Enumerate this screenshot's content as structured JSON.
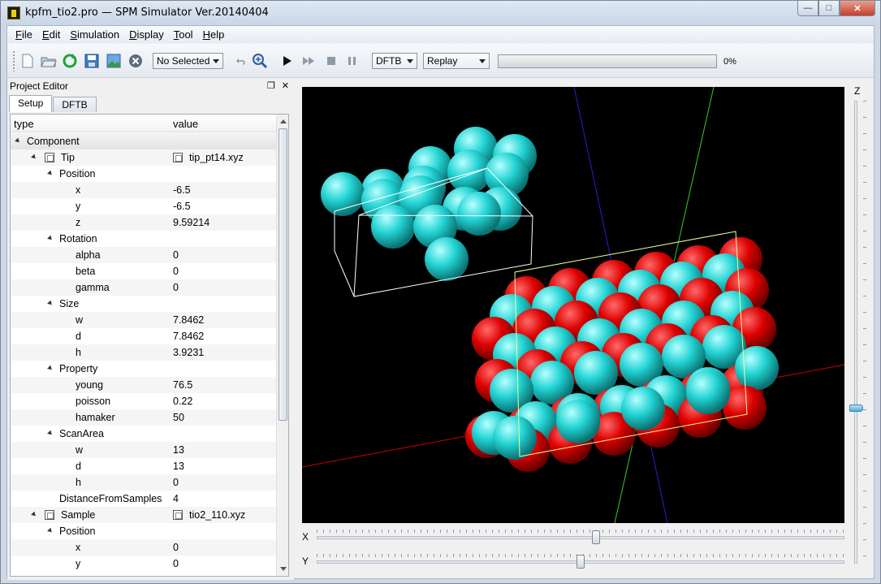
{
  "window": {
    "title": "kpfm_tio2.pro — SPM Simulator Ver.20140404",
    "controls": {
      "minimize": "—",
      "maximize": "□",
      "close": "✕"
    }
  },
  "menu": [
    {
      "first": "F",
      "rest": "ile"
    },
    {
      "first": "E",
      "rest": "dit"
    },
    {
      "first": "S",
      "rest": "imulation"
    },
    {
      "first": "D",
      "rest": "isplay"
    },
    {
      "first": "T",
      "rest": "ool"
    },
    {
      "first": "H",
      "rest": "elp"
    }
  ],
  "toolbar": {
    "selection": "No Selected",
    "mode": "DFTB",
    "playback": "Replay",
    "progress": 0,
    "progress_text": "0%",
    "icons": [
      "new-file-icon",
      "open-folder-icon",
      "refresh-icon",
      "save-icon",
      "image-icon",
      "cancel-icon",
      "undo-icon",
      "zoom-icon",
      "play-icon",
      "fast-forward-icon",
      "stop-icon",
      "pause-icon"
    ]
  },
  "panel": {
    "title": "Project Editor",
    "tabs": [
      "Setup",
      "DFTB"
    ],
    "columns": [
      "type",
      "value"
    ],
    "rows": [
      {
        "level": 0,
        "name": "Component",
        "value": "",
        "expand": true,
        "icon": false,
        "group": true
      },
      {
        "level": 1,
        "name": "Tip",
        "value": "tip_pt14.xyz",
        "expand": true,
        "icon": true
      },
      {
        "level": 2,
        "name": "Position",
        "value": "",
        "expand": true
      },
      {
        "level": 3,
        "name": "x",
        "value": "-6.5"
      },
      {
        "level": 3,
        "name": "y",
        "value": "-6.5"
      },
      {
        "level": 3,
        "name": "z",
        "value": "9.59214"
      },
      {
        "level": 2,
        "name": "Rotation",
        "value": "",
        "expand": true
      },
      {
        "level": 3,
        "name": "alpha",
        "value": "0"
      },
      {
        "level": 3,
        "name": "beta",
        "value": "0"
      },
      {
        "level": 3,
        "name": "gamma",
        "value": "0"
      },
      {
        "level": 2,
        "name": "Size",
        "value": "",
        "expand": true
      },
      {
        "level": 3,
        "name": "w",
        "value": "7.8462"
      },
      {
        "level": 3,
        "name": "d",
        "value": "7.8462"
      },
      {
        "level": 3,
        "name": "h",
        "value": "3.9231"
      },
      {
        "level": 2,
        "name": "Property",
        "value": "",
        "expand": true
      },
      {
        "level": 3,
        "name": "young",
        "value": "76.5"
      },
      {
        "level": 3,
        "name": "poisson",
        "value": "0.22"
      },
      {
        "level": 3,
        "name": "hamaker",
        "value": "50"
      },
      {
        "level": 2,
        "name": "ScanArea",
        "value": "",
        "expand": true
      },
      {
        "level": 3,
        "name": "w",
        "value": "13"
      },
      {
        "level": 3,
        "name": "d",
        "value": "13"
      },
      {
        "level": 3,
        "name": "h",
        "value": "0"
      },
      {
        "level": 2,
        "name": "DistanceFromSamples",
        "value": "4"
      },
      {
        "level": 1,
        "name": "Sample",
        "value": "tio2_110.xyz",
        "expand": true,
        "icon": true
      },
      {
        "level": 2,
        "name": "Position",
        "value": "",
        "expand": true
      },
      {
        "level": 3,
        "name": "x",
        "value": "0"
      },
      {
        "level": 3,
        "name": "y",
        "value": "0"
      }
    ]
  },
  "viewport": {
    "background": "#000000",
    "oxygen_color": "#dd0000",
    "titanium_color": "#22d3d3",
    "axis_colors": {
      "x": "#cc0000",
      "y": "#33cc33",
      "z": "#2222cc"
    }
  },
  "sliders": {
    "x": {
      "label": "X",
      "value": 0.53
    },
    "y": {
      "label": "Y",
      "value": 0.5
    },
    "z": {
      "label": "Z",
      "value": 0.69
    }
  }
}
